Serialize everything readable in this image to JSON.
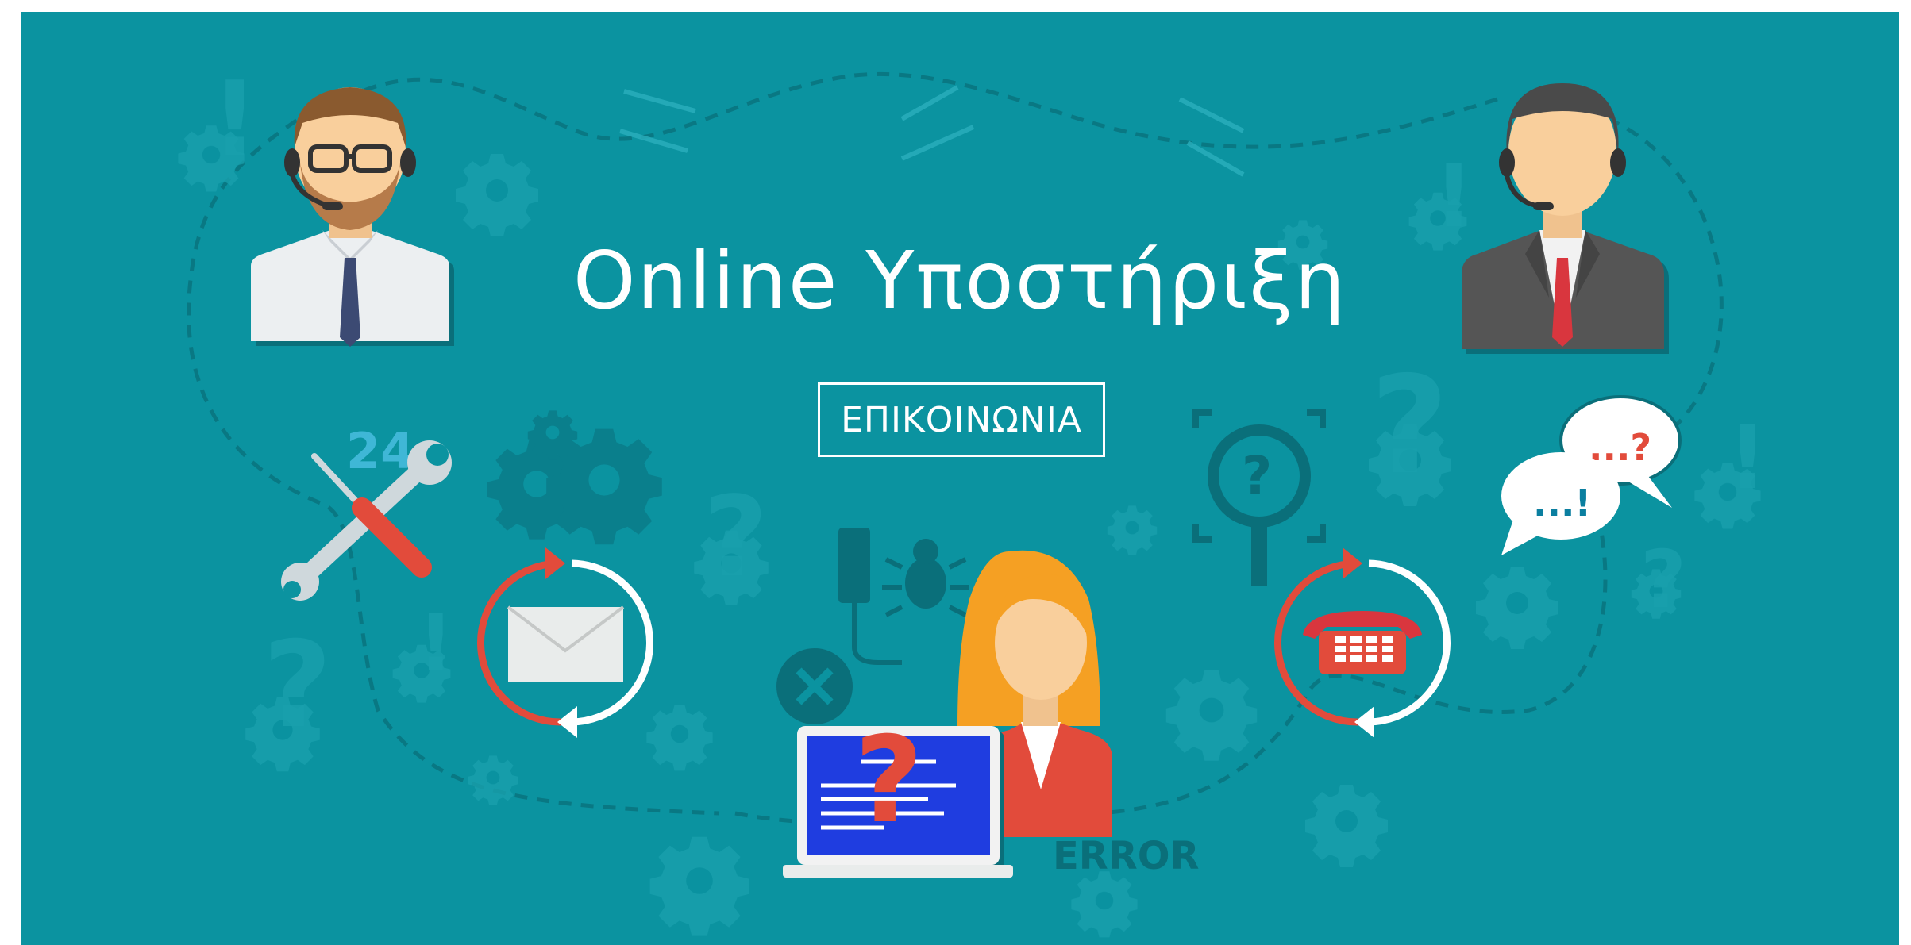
{
  "banner": {
    "title": "Online Υποστήριξη",
    "contact_button": "ΕΠΙΚΟΙΝΩΝΙΑ",
    "badge_24": "24",
    "error_label": "ERROR",
    "bubble_question": "...?",
    "bubble_exclaim": "...!",
    "colors": {
      "background": "#0b93a0",
      "accent_red": "#e24b3b",
      "white": "#ffffff",
      "laptop_screen": "#1f3de0",
      "hair_orange": "#f5a023",
      "skin": "#f9cf9c"
    },
    "icons": [
      "agent-man-glasses-icon",
      "agent-man-suit-icon",
      "agent-woman-icon",
      "tools-icon",
      "email-cycle-icon",
      "phone-cycle-icon",
      "chat-bubbles-icon",
      "magnifier-question-icon",
      "laptop-icon",
      "gear-icon"
    ]
  }
}
